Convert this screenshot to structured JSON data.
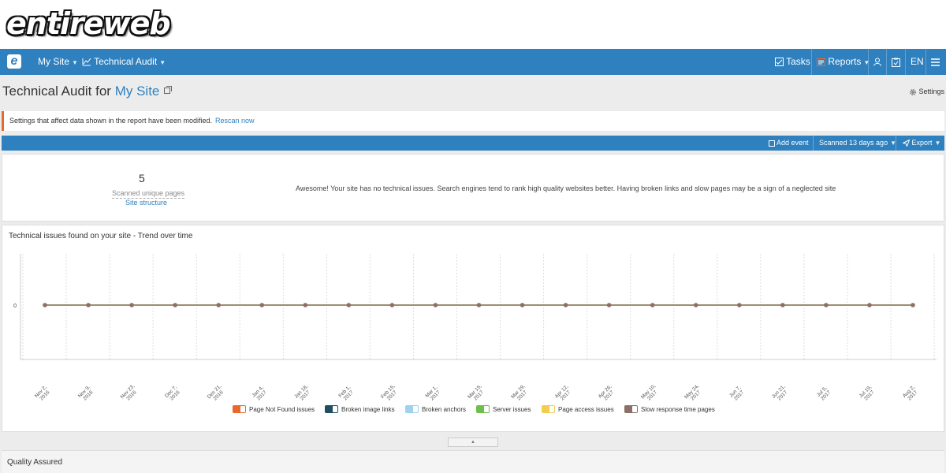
{
  "brand": {
    "logo_text": "entireweb"
  },
  "nav": {
    "logo_letter": "e",
    "site_menu": "My Site",
    "audit_menu": "Technical Audit",
    "tasks": "Tasks",
    "reports": "Reports",
    "language": "EN"
  },
  "header": {
    "title_prefix": "Technical Audit for",
    "site_name": "My Site",
    "settings": "Settings"
  },
  "alert": {
    "message": "Settings that affect data shown in the report have been modified.",
    "link": "Rescan now",
    "accent_color": "#e8692c"
  },
  "toolbar": {
    "add_event": "Add event",
    "scanned": "Scanned 13 days ago",
    "export": "Export"
  },
  "summary": {
    "pages_count": "5",
    "pages_label": "Scanned unique pages",
    "structure_link": "Site structure",
    "message": "Awesome! Your site has no technical issues. Search engines tend to rank high quality websites better. Having broken links and slow pages may be a sign of a neglected site"
  },
  "chart_data": {
    "type": "line",
    "title": "Technical issues found on your site - Trend over time",
    "categories": [
      "Nov 2, 2016",
      "Nov 9, 2016",
      "Nov 23, 2016",
      "Dec 7, 2016",
      "Dec 21, 2016",
      "Jan 4, 2017",
      "Jan 18, 2017",
      "Feb 1, 2017",
      "Feb 15, 2017",
      "Mar 1, 2017",
      "Mar 15, 2017",
      "Mar 29, 2017",
      "Apr 12, 2017",
      "Apr 26, 2017",
      "May 10, 2017",
      "May 24, 2017",
      "Jun 7, 2017",
      "Jun 21, 2017",
      "Jul 5, 2017",
      "Jul 19, 2017",
      "Aug 2, 2017"
    ],
    "y_ticks": [
      "0"
    ],
    "series": [
      {
        "name": "Page Not Found issues",
        "color": "#e8692c",
        "values": [
          0,
          0,
          0,
          0,
          0,
          0,
          0,
          0,
          0,
          0,
          0,
          0,
          0,
          0,
          0,
          0,
          0,
          0,
          0,
          0,
          0
        ]
      },
      {
        "name": "Broken image links",
        "color": "#1f4e5f",
        "values": [
          0,
          0,
          0,
          0,
          0,
          0,
          0,
          0,
          0,
          0,
          0,
          0,
          0,
          0,
          0,
          0,
          0,
          0,
          0,
          0,
          0
        ]
      },
      {
        "name": "Broken anchors",
        "color": "#9ed2ef",
        "values": [
          0,
          0,
          0,
          0,
          0,
          0,
          0,
          0,
          0,
          0,
          0,
          0,
          0,
          0,
          0,
          0,
          0,
          0,
          0,
          0,
          0
        ]
      },
      {
        "name": "Server issues",
        "color": "#6cc04a",
        "values": [
          0,
          0,
          0,
          0,
          0,
          0,
          0,
          0,
          0,
          0,
          0,
          0,
          0,
          0,
          0,
          0,
          0,
          0,
          0,
          0,
          0
        ]
      },
      {
        "name": "Page access issues",
        "color": "#f2cd4f",
        "values": [
          0,
          0,
          0,
          0,
          0,
          0,
          0,
          0,
          0,
          0,
          0,
          0,
          0,
          0,
          0,
          0,
          0,
          0,
          0,
          0,
          0
        ]
      },
      {
        "name": "Slow response time pages",
        "color": "#8c7068",
        "values": [
          0,
          0,
          0,
          0,
          0,
          0,
          0,
          0,
          0,
          0,
          0,
          0,
          0,
          0,
          0,
          0,
          0,
          0,
          0,
          0,
          0
        ]
      }
    ],
    "grid": true,
    "legend_position": "bottom"
  },
  "footer": {
    "collapse_glyph": "▲",
    "quality_title": "Quality Assured"
  }
}
